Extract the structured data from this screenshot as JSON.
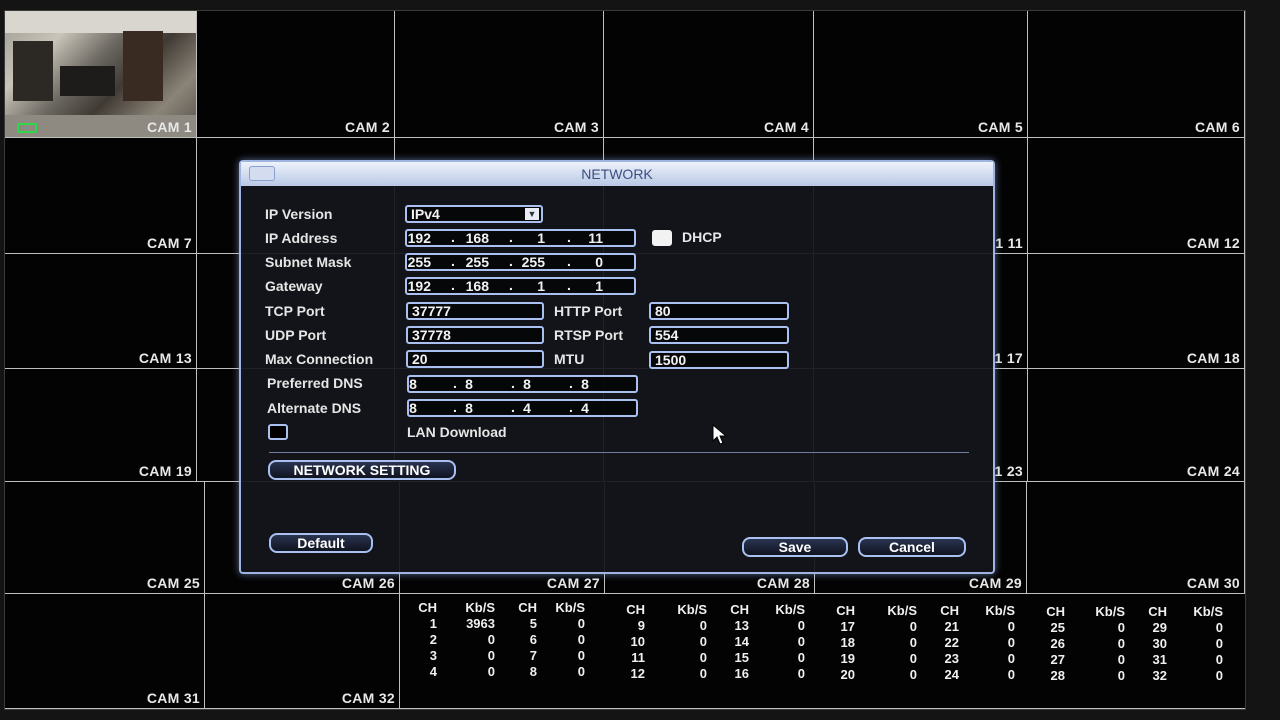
{
  "cameras": {
    "row1": [
      "CAM 1",
      "CAM 2",
      "CAM 3",
      "CAM 4",
      "CAM 5",
      "CAM 6"
    ],
    "right_labels": [
      "CAM 12",
      "CAM 18",
      "CAM 24"
    ],
    "mid_labels": [
      "1 11",
      "1 17",
      "1 23"
    ],
    "left_labels": [
      "CAM 7",
      "CAM 13",
      "CAM 19"
    ],
    "row5": [
      "CAM 25",
      "CAM 26",
      "CAM 27",
      "CAM 28",
      "CAM 29",
      "CAM 30"
    ],
    "row6": [
      "CAM 31",
      "CAM 32"
    ]
  },
  "stats": {
    "headers": [
      "CH",
      "Kb/S",
      "CH",
      "Kb/S"
    ],
    "groups": [
      [
        [
          "1",
          "3963",
          "5",
          "0"
        ],
        [
          "2",
          "0",
          "6",
          "0"
        ],
        [
          "3",
          "0",
          "7",
          "0"
        ],
        [
          "4",
          "0",
          "8",
          "0"
        ]
      ],
      [
        [
          "9",
          "0",
          "13",
          "0"
        ],
        [
          "10",
          "0",
          "14",
          "0"
        ],
        [
          "11",
          "0",
          "15",
          "0"
        ],
        [
          "12",
          "0",
          "16",
          "0"
        ]
      ],
      [
        [
          "17",
          "0",
          "21",
          "0"
        ],
        [
          "18",
          "0",
          "22",
          "0"
        ],
        [
          "19",
          "0",
          "23",
          "0"
        ],
        [
          "20",
          "0",
          "24",
          "0"
        ]
      ],
      [
        [
          "25",
          "0",
          "29",
          "0"
        ],
        [
          "26",
          "0",
          "30",
          "0"
        ],
        [
          "27",
          "0",
          "31",
          "0"
        ],
        [
          "28",
          "0",
          "32",
          "0"
        ]
      ]
    ]
  },
  "dialog": {
    "title": "NETWORK",
    "labels": {
      "ip_version": "IP Version",
      "ip_address": "IP Address",
      "subnet_mask": "Subnet Mask",
      "gateway": "Gateway",
      "tcp_port": "TCP Port",
      "udp_port": "UDP Port",
      "max_connection": "Max Connection",
      "preferred_dns": "Preferred DNS",
      "alternate_dns": "Alternate DNS",
      "http_port": "HTTP Port",
      "rtsp_port": "RTSP Port",
      "mtu": "MTU",
      "dhcp": "DHCP",
      "lan_download": "LAN Download"
    },
    "values": {
      "ip_version": "IPv4",
      "ip_address": [
        "192",
        "168",
        "1",
        "11"
      ],
      "subnet_mask": [
        "255",
        "255",
        "255",
        "0"
      ],
      "gateway": [
        "192",
        "168",
        "1",
        "1"
      ],
      "tcp_port": "37777",
      "udp_port": "37778",
      "max_connection": "20",
      "preferred_dns": [
        "8",
        "8",
        "8",
        "8"
      ],
      "alternate_dns": [
        "8",
        "8",
        "4",
        "4"
      ],
      "http_port": "80",
      "rtsp_port": "554",
      "mtu": "1500",
      "dhcp_checked": true,
      "lan_download_checked": false
    },
    "buttons": {
      "network_setting": "NETWORK SETTING",
      "default": "Default",
      "save": "Save",
      "cancel": "Cancel"
    }
  }
}
